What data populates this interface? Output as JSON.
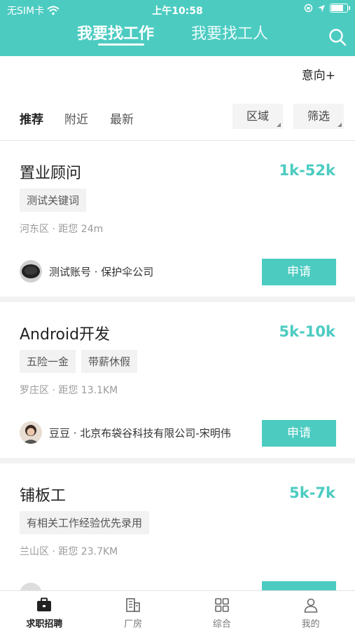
{
  "status_bar": {
    "carrier": "无SIM卡",
    "time": "上午10:58"
  },
  "top_tabs": [
    {
      "label": "我要找工作"
    },
    {
      "label": "我要找工人"
    }
  ],
  "intent": {
    "label": "意向+"
  },
  "filter": {
    "tabs": [
      {
        "label": "推荐"
      },
      {
        "label": "附近"
      },
      {
        "label": "最新"
      }
    ],
    "region_label": "区域",
    "filter_label": "筛选"
  },
  "jobs": [
    {
      "title": "置业顾问",
      "salary": "1k-52k",
      "tags": [
        "测试关键词"
      ],
      "location": "河东区 · 距您 24m",
      "poster": "测试账号 · 保护伞公司",
      "apply_label": "申请"
    },
    {
      "title": "Android开发",
      "salary": "5k-10k",
      "tags": [
        "五险一金",
        "带薪休假"
      ],
      "location": "罗庄区 · 距您 13.1KM",
      "poster": "豆豆 · 北京布袋谷科技有限公司-宋明伟",
      "apply_label": "申请"
    },
    {
      "title": "铺板工",
      "salary": "5k-7k",
      "tags": [
        "有相关工作经验优先录用"
      ],
      "location": "兰山区 · 距您 23.7KM"
    }
  ],
  "bottom_nav": [
    {
      "label": "求职招聘",
      "icon": "briefcase-icon"
    },
    {
      "label": "厂房",
      "icon": "building-icon"
    },
    {
      "label": "综合",
      "icon": "grid-icon"
    },
    {
      "label": "我的",
      "icon": "person-icon"
    }
  ],
  "colors": {
    "accent": "#4ccbc1"
  }
}
